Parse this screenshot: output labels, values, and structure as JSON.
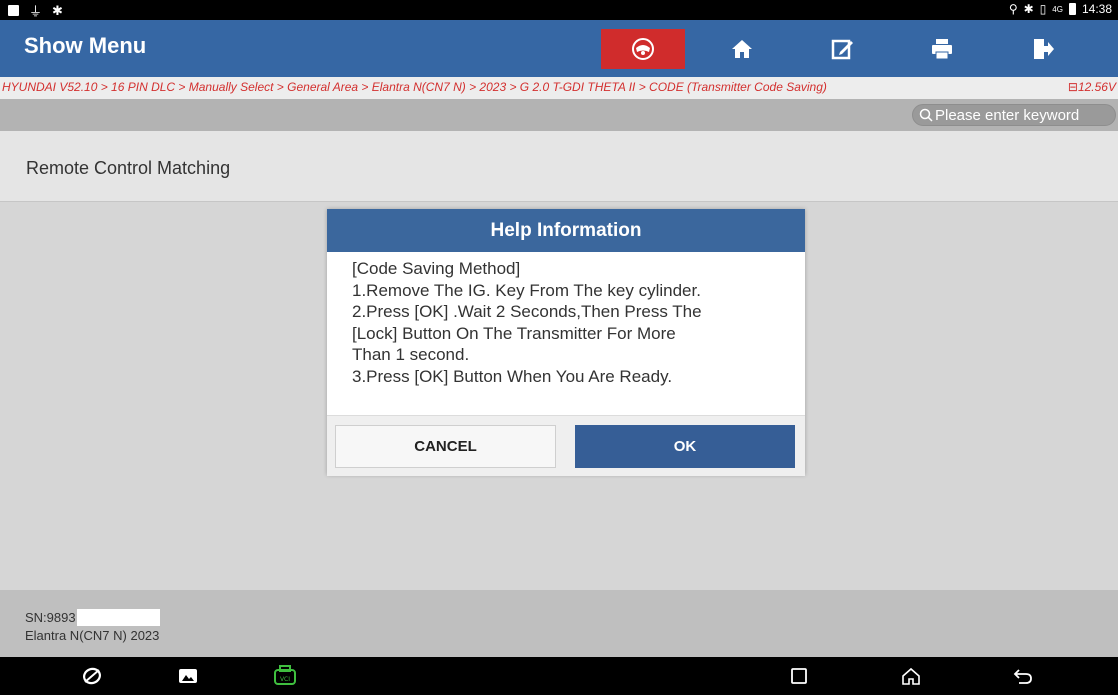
{
  "status_bar": {
    "time": "14:38",
    "signal": "4G"
  },
  "header": {
    "title": "Show Menu",
    "buttons": [
      "diagnose-icon",
      "home-icon",
      "edit-icon",
      "print-icon",
      "exit-icon"
    ]
  },
  "breadcrumb": {
    "path": "HYUNDAI V52.10 > 16 PIN DLC > Manually Select > General Area > Elantra N(CN7 N) > 2023 > G 2.0 T-GDI THETA II > CODE (Transmitter Code Saving)",
    "voltage": "12.56V"
  },
  "search": {
    "placeholder": "Please enter keyword"
  },
  "menu": {
    "items": [
      {
        "label": "Remote Control Matching"
      }
    ]
  },
  "dialog": {
    "title": "Help Information",
    "lines": [
      "[Code Saving Method]",
      "1.Remove The IG. Key From The key cylinder.",
      "2.Press [OK] .Wait 2 Seconds,Then Press The",
      "[Lock] Button On The Transmitter For More",
      "Than 1 second.",
      "3.Press [OK] Button When You Are Ready."
    ],
    "cancel_label": "CANCEL",
    "ok_label": "OK"
  },
  "footer": {
    "sn_label": "SN:9893",
    "vehicle": "Elantra N(CN7 N) 2023"
  },
  "colors": {
    "title_bar": "#3667a4",
    "diag_button": "#d02c2c",
    "breadcrumb_text": "#d3302f",
    "dialog_header": "#3b679d",
    "ok_button": "#365e96"
  }
}
